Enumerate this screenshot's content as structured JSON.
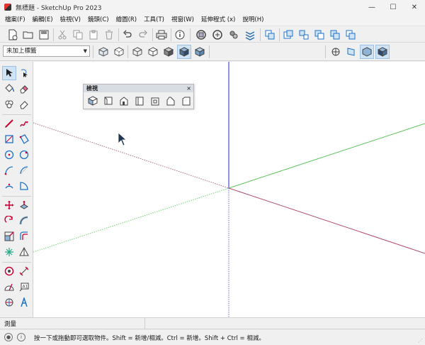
{
  "window": {
    "title": "無標題 - SketchUp Pro 2023",
    "minimize": "—",
    "maximize": "☐",
    "close": "✕"
  },
  "menu": [
    "檔案(F)",
    "編輯(E)",
    "檢視(V)",
    "鏡頭(C)",
    "繪圖(R)",
    "工具(T)",
    "視窗(W)",
    "延伸程式 (x)",
    "說明(H)"
  ],
  "tag_selector": {
    "value": "未加上標籤"
  },
  "views_palette": {
    "title": "檢視",
    "close": "×"
  },
  "measurements": {
    "label": "測量"
  },
  "status": {
    "message": "按一下或拖動即可選取物件。Shift = 新增/相減。Ctrl = 新增。Shift + Ctrl = 相減。"
  },
  "colors": {
    "red_axis": "#b04a6a",
    "green_axis": "#5cc45c",
    "blue_axis": "#4b4bd0",
    "accent": "#1e73c8"
  }
}
